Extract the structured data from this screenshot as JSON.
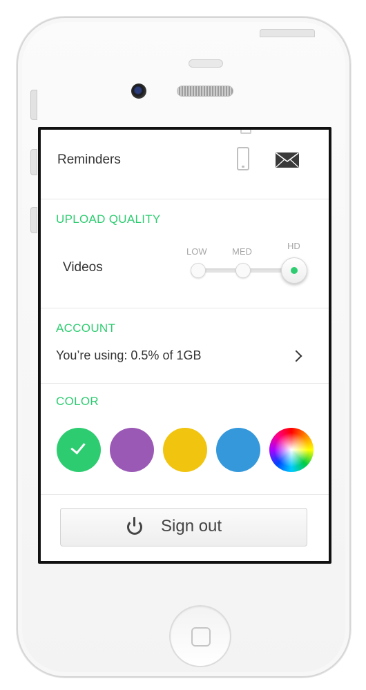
{
  "reminders": {
    "label": "Reminders",
    "icons": [
      "phone-icon",
      "mail-icon"
    ]
  },
  "upload_quality": {
    "title": "UPLOAD QUALITY",
    "label": "Videos",
    "levels": [
      "LOW",
      "MED",
      "HD"
    ],
    "selected": "HD"
  },
  "account": {
    "title": "ACCOUNT",
    "usage_text": "You’re using: 0.5% of 1GB"
  },
  "color": {
    "title": "COLOR",
    "swatches": [
      "#2ecc71",
      "#9b59b6",
      "#f1c40f",
      "#3498db",
      "spectrum"
    ],
    "selected_index": 0
  },
  "signout": {
    "label": "Sign out"
  },
  "colors": {
    "accent": "#2ecc71"
  }
}
